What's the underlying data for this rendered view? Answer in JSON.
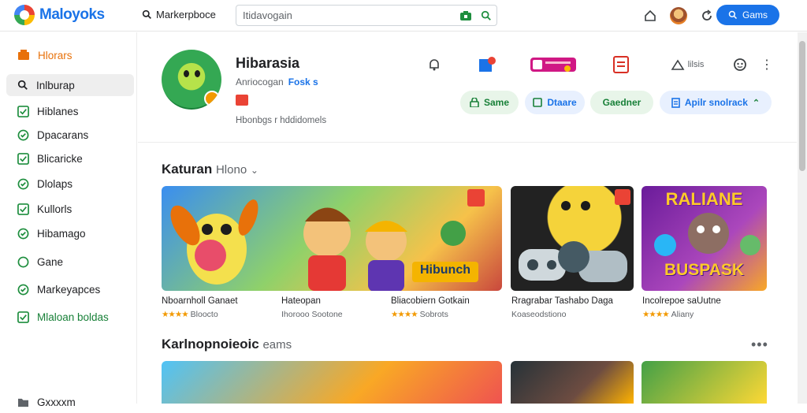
{
  "header": {
    "logo_text": "Maloyoks",
    "market_link": "Markerpboce",
    "search_value": "Itidavogain",
    "games_button": "Gams"
  },
  "sidebar": {
    "items": [
      {
        "label": "Hlorars",
        "icon": "store-icon"
      },
      {
        "label": "Inlburap",
        "icon": "search-icon"
      },
      {
        "label": "Hiblanes",
        "icon": "check-icon"
      },
      {
        "label": "Dpacarans",
        "icon": "check-icon"
      },
      {
        "label": "Blicaricke",
        "icon": "check-icon"
      },
      {
        "label": "Dlolaps",
        "icon": "check-icon"
      },
      {
        "label": "Kullorls",
        "icon": "check-icon"
      },
      {
        "label": "Hibamago",
        "icon": "check-icon"
      },
      {
        "label": "Gane",
        "icon": "circle-icon"
      },
      {
        "label": "Markeyapces",
        "icon": "check-icon"
      },
      {
        "label": "Mlaloan boldas",
        "icon": "check-icon"
      },
      {
        "label": "Gxxxxm",
        "icon": "folder-icon"
      }
    ]
  },
  "app": {
    "title": "Hibarasia",
    "developer": "Anriocogan",
    "developer_link": "Fosk s",
    "meta": "Hbonbgs r hddidomels",
    "tool_label": "lilsis"
  },
  "actions": {
    "same": "Same",
    "store": "Dtaare",
    "gaedner": "Gaedner",
    "apply": "Apilr snolrack"
  },
  "section1": {
    "title": "Katuran",
    "subtitle": "Hlono",
    "cards": [
      {
        "title": "Nboarnholl Ganaet",
        "sub": "Bloocto",
        "stars": "★★★★"
      },
      {
        "title": "Hateopan",
        "sub": "Ihorooo Sootone",
        "stars": ""
      },
      {
        "title": "Bliacobiern Gotkain",
        "sub": "Sobrots",
        "stars": "★★★★"
      },
      {
        "title": "Rragrabar Tashabo Daga",
        "sub": "Koaseodstiono",
        "stars": ""
      },
      {
        "title": "Incolrepoe saUutne",
        "sub": "Aliany",
        "stars": "★★★★"
      }
    ],
    "banner_text": "Hibunch",
    "banner3_top": "RALIANE",
    "banner3_bottom": "BUSPASK"
  },
  "section2": {
    "title": "Karlnopnoieoic",
    "subtitle": "eams"
  },
  "colors": {
    "brand": "#1a73e8",
    "accent_green": "#188038",
    "accent_orange": "#e8710a"
  }
}
